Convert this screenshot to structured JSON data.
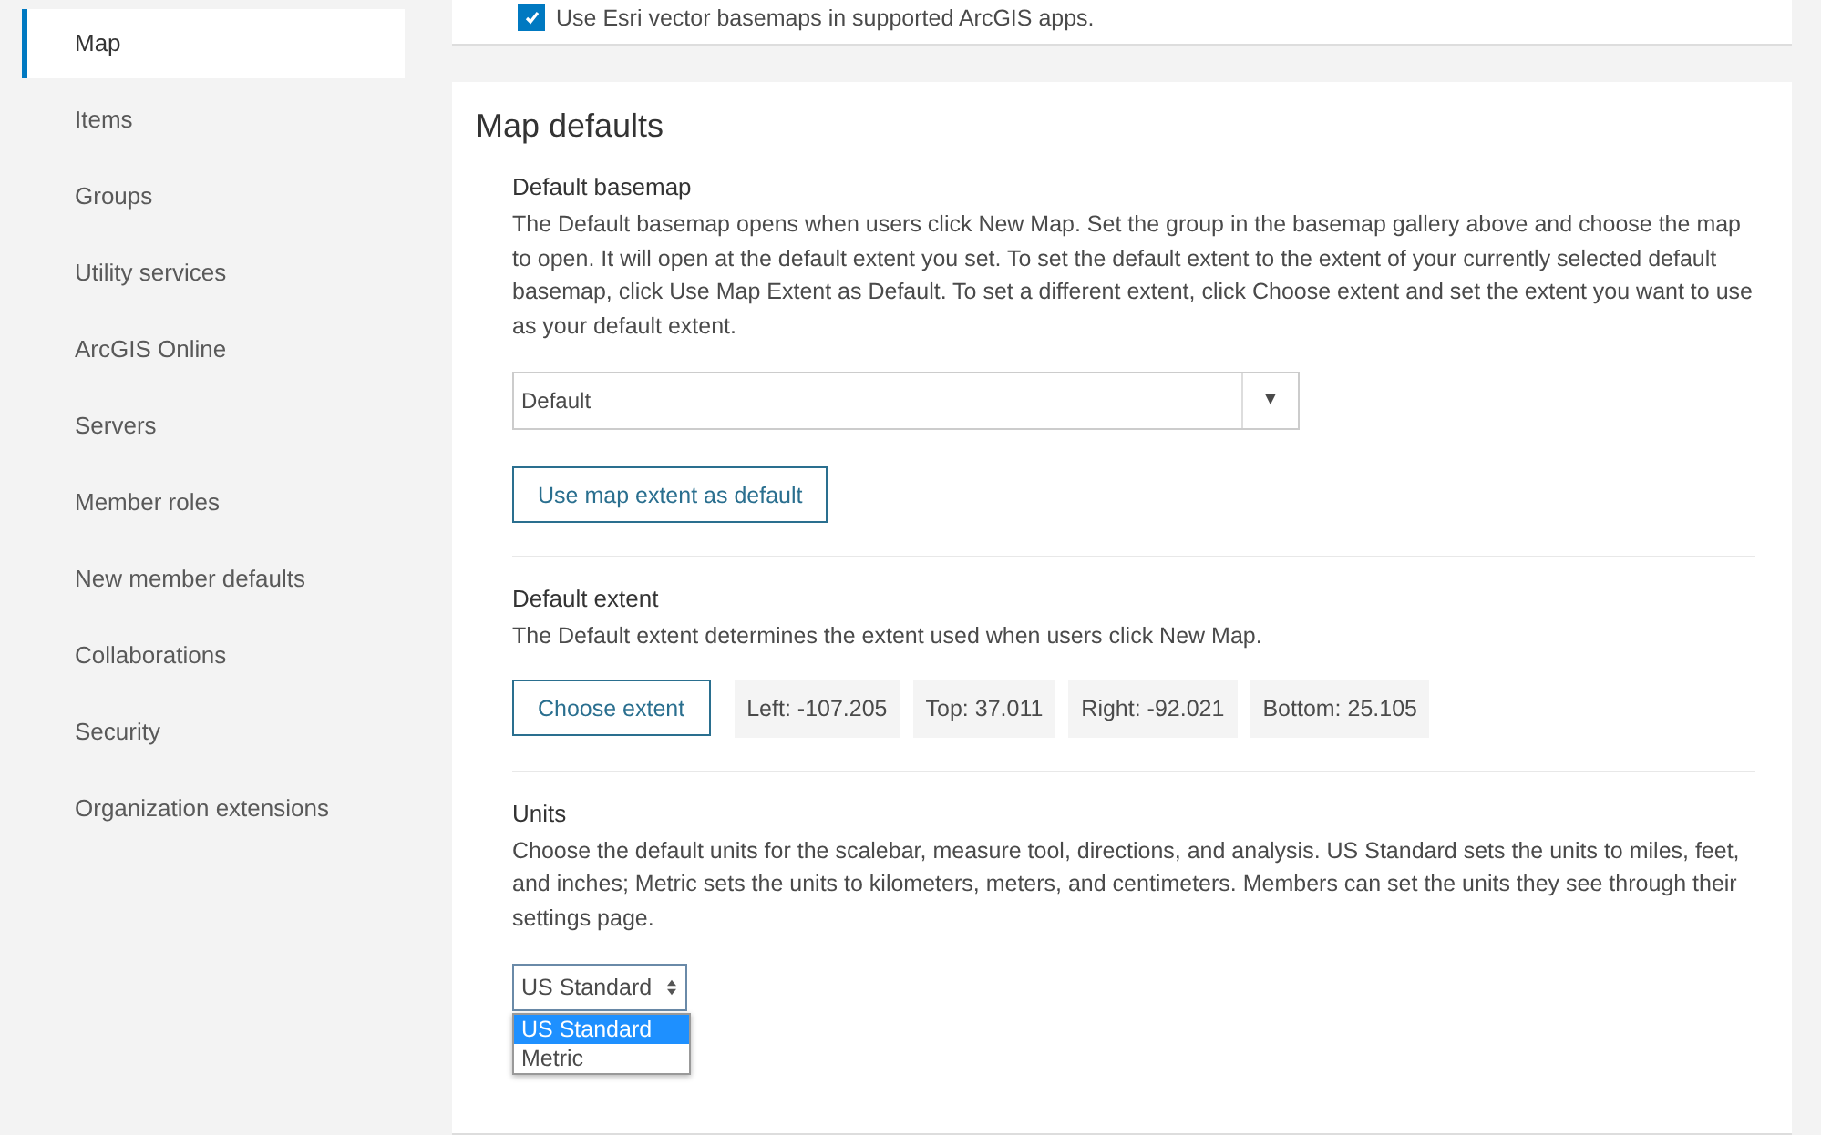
{
  "sidebar": {
    "items": [
      {
        "label": "Map",
        "selected": true
      },
      {
        "label": "Items",
        "selected": false
      },
      {
        "label": "Groups",
        "selected": false
      },
      {
        "label": "Utility services",
        "selected": false
      },
      {
        "label": "ArcGIS Online",
        "selected": false
      },
      {
        "label": "Servers",
        "selected": false
      },
      {
        "label": "Member roles",
        "selected": false
      },
      {
        "label": "New member defaults",
        "selected": false
      },
      {
        "label": "Collaborations",
        "selected": false
      },
      {
        "label": "Security",
        "selected": false
      },
      {
        "label": "Organization extensions",
        "selected": false
      }
    ]
  },
  "top_card": {
    "checkbox": {
      "label": "Use Esri vector basemaps in supported ArcGIS apps.",
      "checked": true
    }
  },
  "map_defaults": {
    "title": "Map defaults",
    "default_basemap": {
      "heading": "Default basemap",
      "description": "The Default basemap opens when users click New Map. Set the group in the basemap gallery above and choose the map to open. It will open at the default extent you set. To set the default extent to the extent of your currently selected default basemap, click Use Map Extent as Default. To set a different extent, click Choose extent and set the extent you want to use as your default extent.",
      "select_value": "Default",
      "select_arrow": "▼",
      "button": "Use map extent as default"
    },
    "default_extent": {
      "heading": "Default extent",
      "description": "The Default extent determines the extent used when users click New Map.",
      "button": "Choose extent",
      "values": [
        "Left: -107.205",
        "Top: 37.011",
        "Right: -92.021",
        "Bottom: 25.105"
      ]
    },
    "units": {
      "heading": "Units",
      "description": "Choose the default units for the scalebar, measure tool, directions, and analysis. US Standard sets the units to miles, feet, and inches; Metric sets the units to kilometers, meters, and centimeters. Members can set the units they see through their settings page.",
      "select_value": "US Standard",
      "options": [
        {
          "label": "US Standard",
          "selected": true
        },
        {
          "label": "Metric",
          "selected": false
        }
      ]
    }
  }
}
